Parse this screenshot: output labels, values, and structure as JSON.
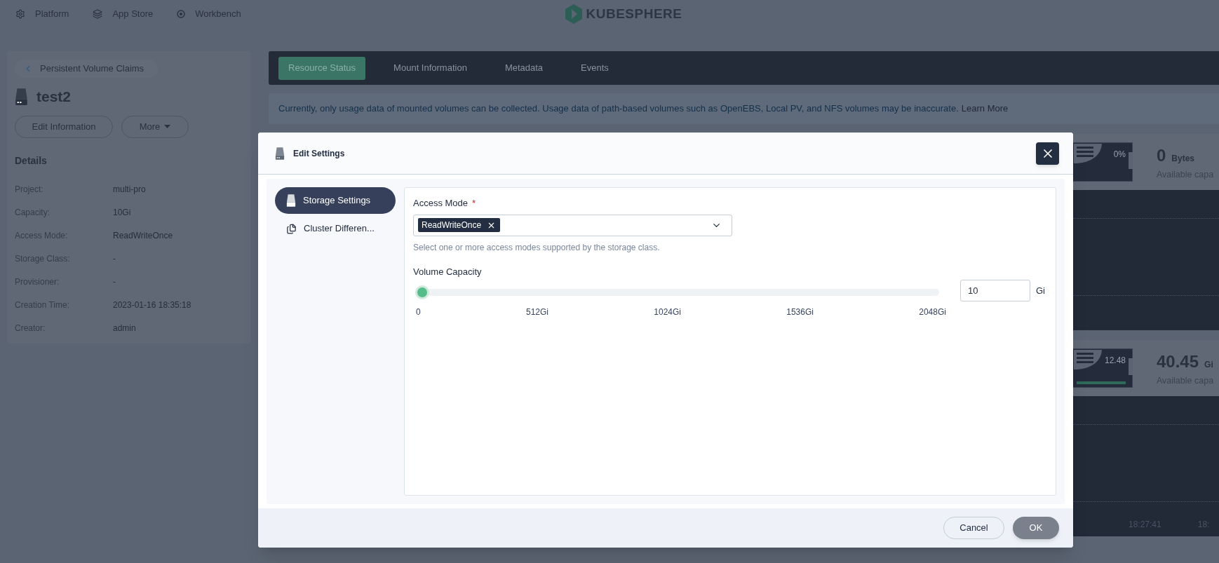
{
  "top_nav": {
    "items": [
      {
        "label": "Platform"
      },
      {
        "label": "App Store"
      },
      {
        "label": "Workbench"
      }
    ],
    "logo": "KUBESPHERE"
  },
  "sidebar": {
    "back_link": "Persistent Volume Claims",
    "title": "test2",
    "buttons": [
      "Edit Information",
      "More"
    ],
    "details_title": "Details",
    "details": [
      {
        "label": "Project:",
        "value": "multi-pro"
      },
      {
        "label": "Capacity:",
        "value": "10Gi"
      },
      {
        "label": "Access Mode:",
        "value": "ReadWriteOnce"
      },
      {
        "label": "Storage Class:",
        "value": "-"
      },
      {
        "label": "Provisioner:",
        "value": "-"
      },
      {
        "label": "Creation Time:",
        "value": "2023-01-16 18:35:18"
      },
      {
        "label": "Creator:",
        "value": "admin"
      }
    ]
  },
  "tabs": [
    {
      "label": "Resource Status",
      "selected": true
    },
    {
      "label": "Mount Information",
      "selected": false
    },
    {
      "label": "Metadata",
      "selected": false
    },
    {
      "label": "Events",
      "selected": false
    }
  ],
  "notice": {
    "text": "Currently, only usage data of mounted volumes can be collected. Usage data of path-based volumes such as OpenEBS, Local PV, and NFS volumes may be inaccurate.",
    "link": "Learn More"
  },
  "cards": [
    {
      "percent": "0%",
      "value": "0",
      "unit": "Bytes",
      "caption": "Available capa"
    },
    {
      "percent": "12.48",
      "value": "40.45",
      "unit": "Gi",
      "caption": "Available capa",
      "times": [
        "18:27:41",
        "18:"
      ]
    }
  ],
  "modal": {
    "title": "Edit Settings",
    "nav": [
      {
        "label": "Storage Settings",
        "selected": true
      },
      {
        "label": "Cluster Differen...",
        "selected": false
      }
    ],
    "access_mode": {
      "label": "Access Mode",
      "required_mark": "*",
      "tags": [
        "ReadWriteOnce"
      ],
      "hint": "Select one or more access modes supported by the storage class."
    },
    "capacity": {
      "label": "Volume Capacity",
      "level": 0.005,
      "ticks": [
        "0",
        "512Gi",
        "1024Gi",
        "1536Gi",
        "2048Gi"
      ],
      "value": "10",
      "unit": "Gi"
    },
    "buttons": {
      "cancel": "Cancel",
      "ok": "OK"
    }
  }
}
